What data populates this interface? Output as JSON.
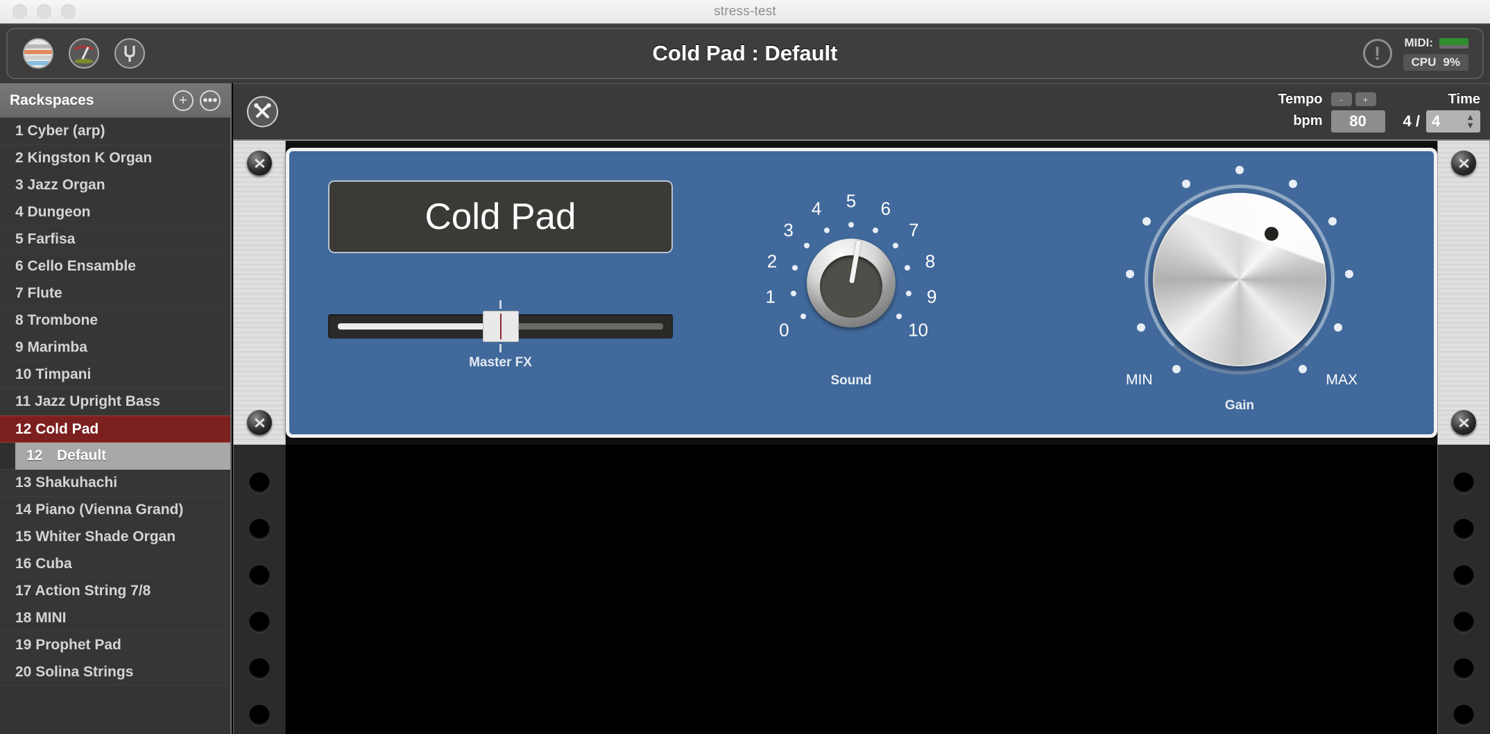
{
  "window": {
    "title": "stress-test"
  },
  "toolbar": {
    "app_title": "Cold Pad : Default",
    "icons": [
      {
        "name": "rackspaces-icon",
        "label": "Rackspaces"
      },
      {
        "name": "gauge-icon",
        "label": "Meters"
      },
      {
        "name": "tuning-fork-icon",
        "label": "Tuner"
      }
    ],
    "warning_icon": "!",
    "midi_label": "MIDI:",
    "cpu_label": "CPU",
    "cpu_value": "9%",
    "midi_led_color": "#2f8f2f"
  },
  "sidebar": {
    "header": "Rackspaces",
    "add_button": "+",
    "more_button": "•••",
    "items": [
      {
        "num": "1",
        "label": "Cyber (arp)"
      },
      {
        "num": "2",
        "label": "Kingston K Organ"
      },
      {
        "num": "3",
        "label": "Jazz Organ"
      },
      {
        "num": "4",
        "label": "Dungeon"
      },
      {
        "num": "5",
        "label": "Farfisa"
      },
      {
        "num": "6",
        "label": "Cello Ensamble"
      },
      {
        "num": "7",
        "label": "Flute"
      },
      {
        "num": "8",
        "label": "Trombone"
      },
      {
        "num": "9",
        "label": "Marimba"
      },
      {
        "num": "10",
        "label": "Timpani"
      },
      {
        "num": "11",
        "label": "Jazz Upright Bass"
      },
      {
        "num": "12",
        "label": "Cold Pad",
        "selected": true,
        "variation": {
          "num": "12",
          "label": "Default",
          "selected": true
        }
      },
      {
        "num": "13",
        "label": "Shakuhachi"
      },
      {
        "num": "14",
        "label": "Piano (Vienna Grand)"
      },
      {
        "num": "15",
        "label": "Whiter Shade Organ"
      },
      {
        "num": "16",
        "label": "Cuba"
      },
      {
        "num": "17",
        "label": "Action String 7/8"
      },
      {
        "num": "18",
        "label": "MINI"
      },
      {
        "num": "19",
        "label": "Prophet Pad"
      },
      {
        "num": "20",
        "label": "Solina Strings"
      }
    ],
    "selected_color": "#7c1f1f"
  },
  "rack_header": {
    "tools_icon": "tools-icon",
    "tempo_label": "Tempo",
    "bpm_label": "bpm",
    "bpm_value": "80",
    "minus_button": "-",
    "plus_button": "+",
    "time_label": "Time",
    "time_numerator": "4 /",
    "time_denominator": "4"
  },
  "panel": {
    "name": "Cold Pad",
    "accent_color": "#41699B",
    "slider": {
      "caption": "Master FX",
      "value_percent": 50
    },
    "sound_knob": {
      "caption": "Sound",
      "ticks": [
        "0",
        "1",
        "2",
        "3",
        "4",
        "5",
        "6",
        "7",
        "8",
        "9",
        "10"
      ],
      "value": 5.4,
      "min": 0,
      "max": 10
    },
    "gain_knob": {
      "caption": "Gain",
      "min_label": "MIN",
      "max_label": "MAX",
      "value_percent": 62
    }
  }
}
